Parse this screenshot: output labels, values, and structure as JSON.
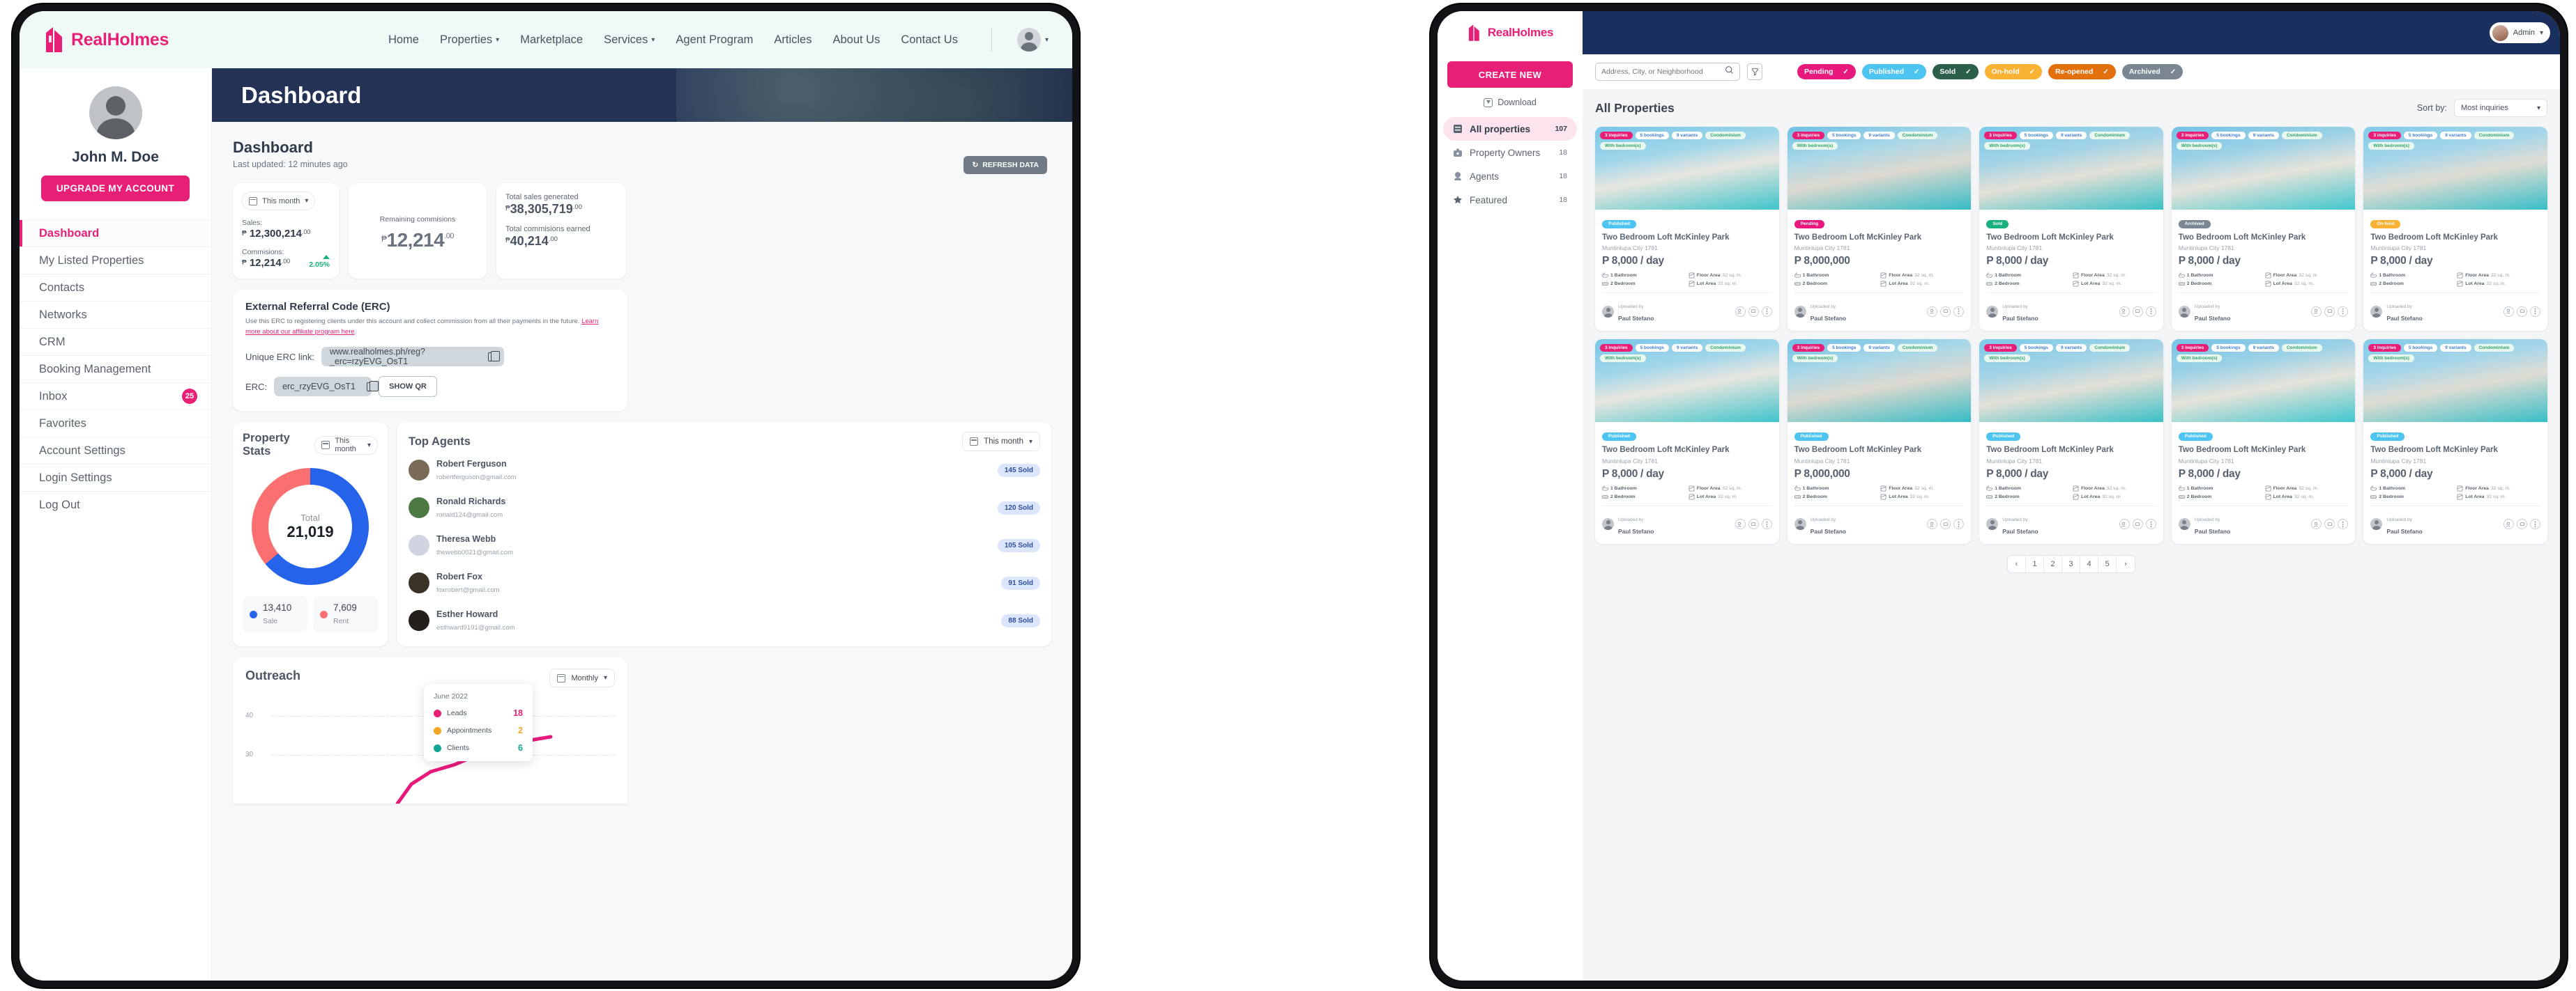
{
  "brand": {
    "name": "RealHolmes",
    "accent": "#e81f76"
  },
  "left": {
    "nav": [
      {
        "label": "Home",
        "caret": false
      },
      {
        "label": "Properties",
        "caret": true
      },
      {
        "label": "Marketplace",
        "caret": false
      },
      {
        "label": "Services",
        "caret": true
      },
      {
        "label": "Agent Program",
        "caret": false
      },
      {
        "label": "Articles",
        "caret": false
      },
      {
        "label": "About Us",
        "caret": false
      },
      {
        "label": "Contact Us",
        "caret": false
      }
    ],
    "profile": {
      "name": "John M. Doe",
      "upgrade_label": "UPGRADE MY ACCOUNT"
    },
    "menu": [
      {
        "label": "Dashboard",
        "active": true,
        "badge": ""
      },
      {
        "label": "My Listed Properties",
        "active": false,
        "badge": ""
      },
      {
        "label": "Contacts",
        "active": false,
        "badge": ""
      },
      {
        "label": "Networks",
        "active": false,
        "badge": ""
      },
      {
        "label": "CRM",
        "active": false,
        "badge": ""
      },
      {
        "label": "Booking Management",
        "active": false,
        "badge": ""
      },
      {
        "label": "Inbox",
        "active": false,
        "badge": "25"
      },
      {
        "label": "Favorites",
        "active": false,
        "badge": ""
      },
      {
        "label": "Account Settings",
        "active": false,
        "badge": ""
      },
      {
        "label": "Login Settings",
        "active": false,
        "badge": ""
      },
      {
        "label": "Log Out",
        "active": false,
        "badge": ""
      }
    ],
    "hero_title": "Dashboard",
    "page_title": "Dashboard",
    "last_updated": "Last updated: 12 minutes ago",
    "refresh_label": "REFRESH DATA",
    "kpi": {
      "period": "This month",
      "sales_label": "Sales:",
      "sales_value": "12,300,214",
      "sales_cents": ".00",
      "commissions_label": "Commisions:",
      "commissions_value": "12,214",
      "commissions_cents": ".00",
      "change_pct": "2.05%",
      "remaining_label": "Remaining commisions",
      "remaining_value": "12,214",
      "remaining_cents": ".00",
      "total_sales_label": "Total sales generated",
      "total_sales_value": "38,305,719",
      "total_sales_cents": ".00",
      "total_comm_label": "Total commisions earned",
      "total_comm_value": "40,214",
      "total_comm_cents": ".00",
      "peso": "₱"
    },
    "erc": {
      "title": "External Referral Code (ERC)",
      "desc_before": "Use this ERC to registering clients under this account and collect commission from all their payments in the future. ",
      "link_text": "Learn more about our affiliate program here",
      "desc_after": ".",
      "link_label": "Unique ERC link:",
      "link_value": "www.realholmes.ph/reg?_erc=rzyEVG_OsT1",
      "code_label": "ERC:",
      "code_value": "erc_rzyEVG_OsT1",
      "qr_label": "SHOW QR"
    },
    "property_stats": {
      "title": "Property Stats",
      "period": "This month",
      "total_label": "Total",
      "total_value": "21,019",
      "legend": [
        {
          "value": "13,410",
          "label": "Sale",
          "color": "#2563eb"
        },
        {
          "value": "7,609",
          "label": "Rent",
          "color": "#fa7070"
        }
      ]
    },
    "top_agents": {
      "title": "Top Agents",
      "period": "This month",
      "agents": [
        {
          "name": "Robert Ferguson",
          "email": "robertferguson@gmail.com",
          "sold": "145 Sold",
          "color": "#7a6a58"
        },
        {
          "name": "Ronald Richards",
          "email": "ronald124@gmail.com",
          "sold": "120 Sold",
          "color": "#4d7a44"
        },
        {
          "name": "Theresa Webb",
          "email": "thewebb0021@gmail.com",
          "sold": "105 Sold",
          "color": "#cfd4e0"
        },
        {
          "name": "Robert Fox",
          "email": "foxrobert@gmail.com",
          "sold": "91 Sold",
          "color": "#3a3226"
        },
        {
          "name": "Esther Howard",
          "email": "esthward9191@gmail.com",
          "sold": "88 Sold",
          "color": "#241e1c"
        }
      ]
    },
    "outreach": {
      "title": "Outreach",
      "period": "Monthly",
      "yticks": [
        "40",
        "30"
      ],
      "tooltip": {
        "date": "June 2022",
        "rows": [
          {
            "label": "Leads",
            "value": "18",
            "color": "#e81f76"
          },
          {
            "label": "Appointments",
            "value": "2",
            "color": "#f5a623"
          },
          {
            "label": "Clients",
            "value": "6",
            "color": "#12a594"
          }
        ]
      }
    }
  },
  "right": {
    "user": "Admin",
    "create_label": "CREATE NEW",
    "download_label": "Download",
    "menu": [
      {
        "label": "All properties",
        "count": "107",
        "active": true,
        "icon": "list-icon"
      },
      {
        "label": "Property Owners",
        "count": "18",
        "active": false,
        "icon": "briefcase-icon"
      },
      {
        "label": "Agents",
        "count": "18",
        "active": false,
        "icon": "user-icon"
      },
      {
        "label": "Featured",
        "count": "18",
        "active": false,
        "icon": "star-icon"
      }
    ],
    "search_placeholder": "Address, City, or Neighborhood",
    "search_value": "",
    "chips": [
      {
        "label": "Pending",
        "color": "#e8197c"
      },
      {
        "label": "Published",
        "color": "#4ec5f1"
      },
      {
        "label": "Sold",
        "color": "#2c5f4a"
      },
      {
        "label": "On-hold",
        "color": "#f9b233"
      },
      {
        "label": "Re-opened",
        "color": "#e2700d"
      },
      {
        "label": "Archived",
        "color": "#7a8692"
      }
    ],
    "list_title": "All Properties",
    "sort_label": "Sort by:",
    "sort_value": "Most inquiries",
    "pagination": [
      "‹",
      "1",
      "2",
      "3",
      "4",
      "5",
      "›"
    ],
    "card_common": {
      "tags": [
        "3 inquiries",
        "5 bookings",
        "9 variants"
      ],
      "type_tags": [
        "Condominium",
        "With bedroom(s)"
      ],
      "title": "Two Bedroom Loft McKinley Park",
      "address": "Muntinlupa City 1781",
      "bathroom": "1 Bathroom",
      "bedroom": "2 Bedroom",
      "floor_area_label": "Floor Area",
      "floor_area": "32 sq. m.",
      "lot_area_label": "Lot Area",
      "lot_area": "32 sq. m.",
      "uploaded_by_label": "Uploaded by",
      "uploaded_by": "Paul Stefano"
    },
    "cards": [
      {
        "status": "Published",
        "status_color": "#4ec5f1",
        "price": "P 8,000 / day",
        "img": "a"
      },
      {
        "status": "Pending",
        "status_color": "#e8197c",
        "price": "P 8,000,000",
        "img": "b"
      },
      {
        "status": "Sold",
        "status_color": "#17b07e",
        "price": "P 8,000 / day",
        "img": "c"
      },
      {
        "status": "Archived",
        "status_color": "#7a8692",
        "price": "P 8,000 / day",
        "img": "d"
      },
      {
        "status": "On-hold",
        "status_color": "#f9b233",
        "price": "P 8,000 / day",
        "img": "e"
      },
      {
        "status": "Published",
        "status_color": "#4ec5f1",
        "price": "P 8,000 / day",
        "img": "a"
      },
      {
        "status": "Published",
        "status_color": "#4ec5f1",
        "price": "P 8,000,000",
        "img": "b"
      },
      {
        "status": "Published",
        "status_color": "#4ec5f1",
        "price": "P 8,000 / day",
        "img": "c"
      },
      {
        "status": "Published",
        "status_color": "#4ec5f1",
        "price": "P 8,000 / day",
        "img": "d"
      },
      {
        "status": "Published",
        "status_color": "#4ec5f1",
        "price": "P 8,000 / day",
        "img": "e"
      }
    ]
  }
}
